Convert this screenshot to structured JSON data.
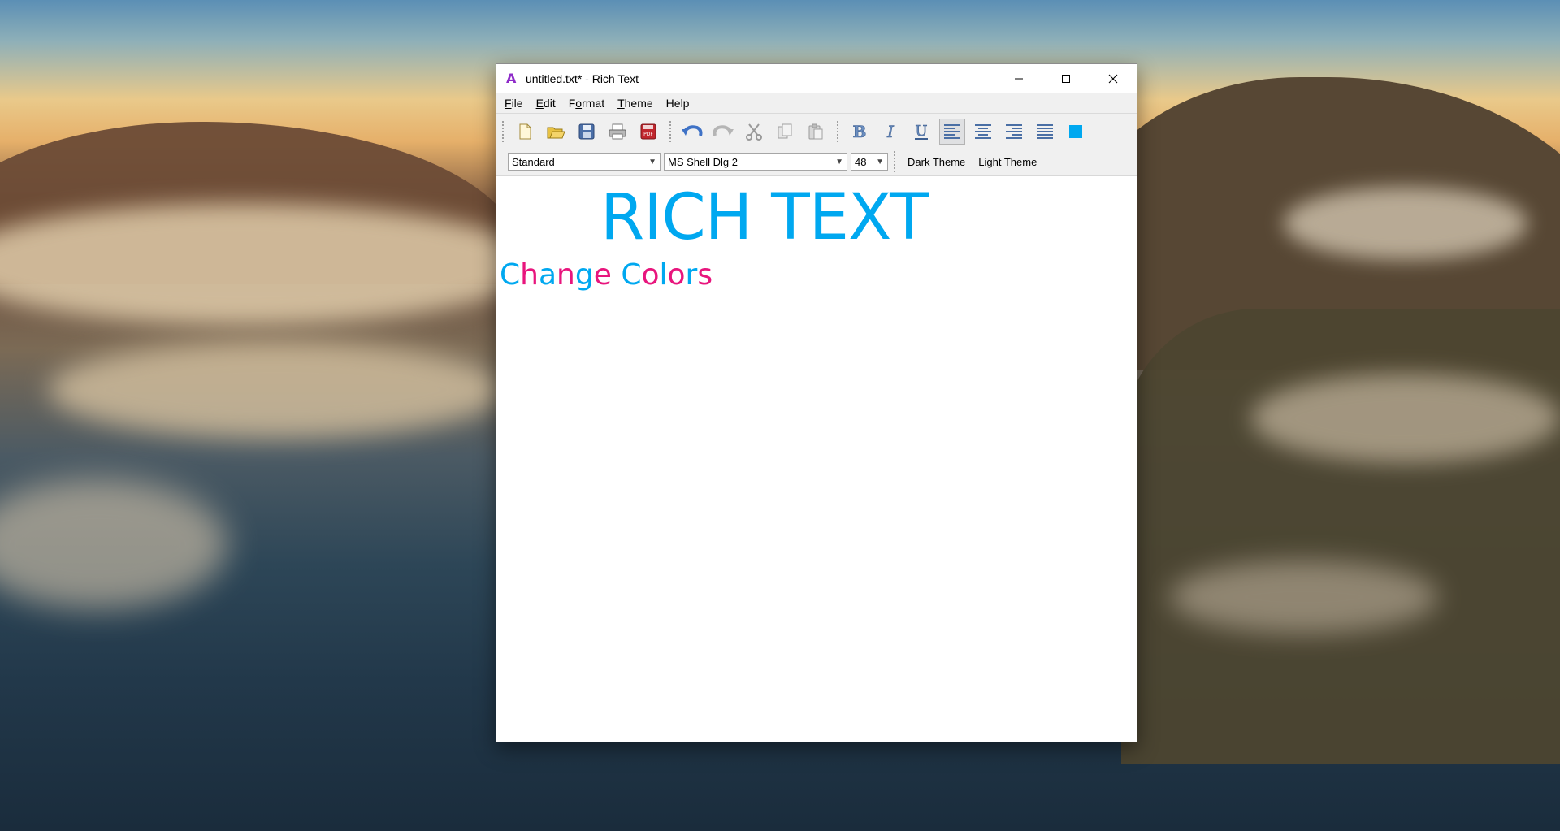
{
  "window": {
    "title": "untitled.txt* - Rich Text",
    "logo_letter": "A",
    "controls": {
      "minimize": "—",
      "maximize": "☐",
      "close": "✕"
    }
  },
  "menu": [
    {
      "label": "File",
      "mnemonic": "F",
      "rest": "ile"
    },
    {
      "label": "Edit",
      "mnemonic": "E",
      "rest": "dit"
    },
    {
      "label": "Format",
      "mnemonic": "o",
      "prefix": "F",
      "rest": "rmat"
    },
    {
      "label": "Theme",
      "mnemonic": "T",
      "rest": "heme"
    },
    {
      "label": "Help",
      "mnemonic": "",
      "rest": "Help"
    }
  ],
  "toolbar": {
    "buttons": [
      "new-file-icon",
      "open-folder-icon",
      "save-icon",
      "print-icon",
      "export-pdf-icon",
      "undo-icon",
      "redo-icon",
      "cut-icon",
      "copy-icon",
      "paste-icon",
      "bold-icon",
      "italic-icon",
      "underline-icon",
      "align-left-icon",
      "align-center-icon",
      "align-right-icon",
      "justify-icon",
      "text-color-icon"
    ],
    "pressed": "align-left-icon",
    "text_color": "#00a8f0"
  },
  "formatbar": {
    "style": "Standard",
    "font": "MS Shell Dlg 2",
    "size": "48",
    "dark_theme": "Dark Theme",
    "light_theme": "Light Theme"
  },
  "document": {
    "heading": "RICH TEXT",
    "heading_color": "#00a8f0",
    "line2": [
      {
        "text": "C",
        "color": "#00a8f0"
      },
      {
        "text": "h",
        "color": "#e8157d"
      },
      {
        "text": "a",
        "color": "#00a8f0"
      },
      {
        "text": "n",
        "color": "#e8157d"
      },
      {
        "text": "g",
        "color": "#00a8f0"
      },
      {
        "text": "e",
        "color": "#e8157d"
      },
      {
        "text": " ",
        "color": "#00a8f0"
      },
      {
        "text": "C",
        "color": "#00a8f0"
      },
      {
        "text": "o",
        "color": "#e8157d"
      },
      {
        "text": "l",
        "color": "#00a8f0"
      },
      {
        "text": "o",
        "color": "#e8157d"
      },
      {
        "text": "r",
        "color": "#00a8f0"
      },
      {
        "text": "s",
        "color": "#e8157d"
      }
    ]
  }
}
